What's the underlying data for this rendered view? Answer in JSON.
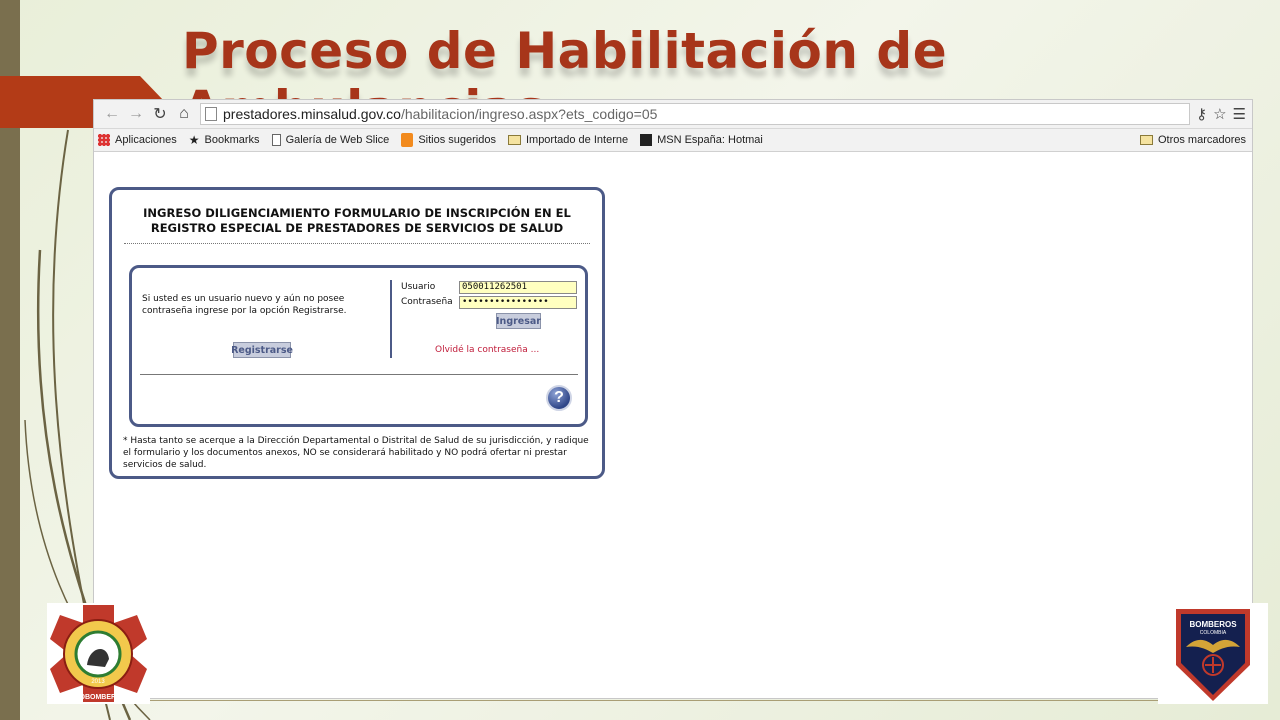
{
  "slide": {
    "title": "Proceso de Habilitación de Ambulancias"
  },
  "browser": {
    "url_host": "prestadores.minsalud.gov.co",
    "url_path": "/habilitacion/ingreso.aspx?ets_codigo=05",
    "bookmarks": [
      {
        "label": "Aplicaciones",
        "icon": "apps-grid-icon"
      },
      {
        "label": "Bookmarks",
        "icon": "star-icon"
      },
      {
        "label": "Galería de Web Slice",
        "icon": "page-icon"
      },
      {
        "label": "Sitios sugeridos",
        "icon": "suggested-sites-icon"
      },
      {
        "label": "Importado de Interne",
        "icon": "folder-icon"
      },
      {
        "label": "MSN España: Hotmai",
        "icon": "msn-icon"
      }
    ],
    "other_bookmarks": "Otros marcadores"
  },
  "form": {
    "title_line1": "INGRESO DILIGENCIAMIENTO FORMULARIO DE INSCRIPCIÓN EN EL",
    "title_line2": "REGISTRO ESPECIAL DE PRESTADORES DE SERVICIOS DE SALUD",
    "new_user_text": "Si usted es un usuario nuevo y aún no posee contraseña ingrese por la opción Registrarse.",
    "register_button": "Registrarse",
    "user_label": "Usuario",
    "user_value": "050011262501",
    "password_label": "Contraseña",
    "password_value": "••••••••••••••••",
    "login_button": "Ingresar",
    "forgot_link": "Olvidé la contraseña ...",
    "help_symbol": "?",
    "note": "* Hasta tanto se acerque a la Dirección Departamental o Distrital de Salud de su jurisdicción, y radique el formulario y los documentos anexos, NO se considerará habilitado y NO podrá ofertar ni prestar servicios de salud."
  },
  "logos": {
    "left_ring_top": "FEDERACIÓN DE CUERPOS DE BOMBEROS DE ANTIOQUIA",
    "left_year": "2013",
    "left_bottom": "ASOBOMBEROS",
    "right_line1": "BOMBEROS",
    "right_line2": "COLOMBIA"
  },
  "colors": {
    "title": "#a7351a",
    "panel_border": "#4c5a87",
    "link": "#c01c3a",
    "field_bg": "#ffffc0"
  }
}
